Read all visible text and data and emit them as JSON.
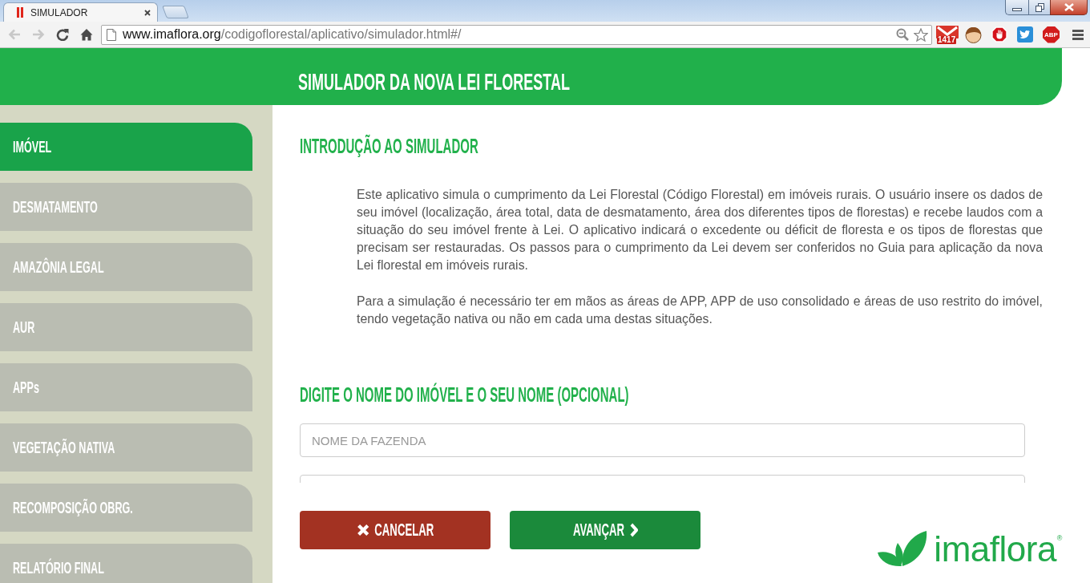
{
  "browser": {
    "tabs": [
      {
        "title": "SIMULADOR",
        "selected": true
      }
    ],
    "nav": [
      {
        "kind": "back",
        "disabled": true
      },
      {
        "kind": "forward",
        "disabled": true
      },
      {
        "kind": "reload",
        "disabled": false
      },
      {
        "kind": "home",
        "disabled": false
      }
    ],
    "address": {
      "host": "www.imaflora.org",
      "path": "/codigoflorestal/aplicativo/simulador.html#/"
    },
    "extensions": [
      {
        "kind": "mail",
        "badge": "1417"
      },
      {
        "kind": "avatar"
      },
      {
        "kind": "stop"
      },
      {
        "kind": "bird"
      },
      {
        "kind": "adblock",
        "label": "ABP"
      }
    ]
  },
  "page": {
    "title": "SIMULADOR DA NOVA LEI FLORESTAL",
    "sidebar": {
      "items": [
        {
          "label": "IMÓVEL",
          "selected": true
        },
        {
          "label": "DESMATAMENTO",
          "selected": false
        },
        {
          "label": "AMAZÔNIA LEGAL",
          "selected": false
        },
        {
          "label": "AUR",
          "selected": false
        },
        {
          "label": "APPs",
          "selected": false
        },
        {
          "label": "VEGETAÇÃO NATIVA",
          "selected": false
        },
        {
          "label": "RECOMPOSIÇÃO OBRG.",
          "selected": false
        },
        {
          "label": "RELATÓRIO FINAL",
          "selected": false
        }
      ]
    },
    "intro": {
      "heading": "INTRODUÇÃO AO SIMULADOR",
      "paragraphs": [
        "Este aplicativo simula o cumprimento da Lei Florestal (Código Florestal) em imóveis rurais. O usuário insere os dados de seu imóvel (localização, área total, data de desmatamento, área dos diferentes tipos de florestas) e recebe laudos com a situação do seu imóvel frente à Lei. O aplicativo indicará o excedente ou déficit de floresta e os tipos de florestas que precisam ser restauradas. Os passos para o cumprimento da Lei devem ser conferidos no Guia para aplicação da nova Lei florestal em imóveis rurais.",
        "Para a simulação é necessário ter em mãos as áreas de APP, APP de uso consolidado e áreas de uso restrito do imóvel, tendo vegetação nativa ou não em cada uma destas situações."
      ]
    },
    "form": {
      "heading": "DIGITE O NOME DO IMÓVEL E O SEU NOME (OPCIONAL)",
      "fields": [
        {
          "placeholder": "NOME DA FAZENDA"
        }
      ]
    },
    "buttons": [
      {
        "kind": "cancel",
        "label": "CANCELAR"
      },
      {
        "kind": "next",
        "label": "AVANÇAR"
      }
    ],
    "logo": {
      "text": "imaflora$^{®}$"
    }
  }
}
